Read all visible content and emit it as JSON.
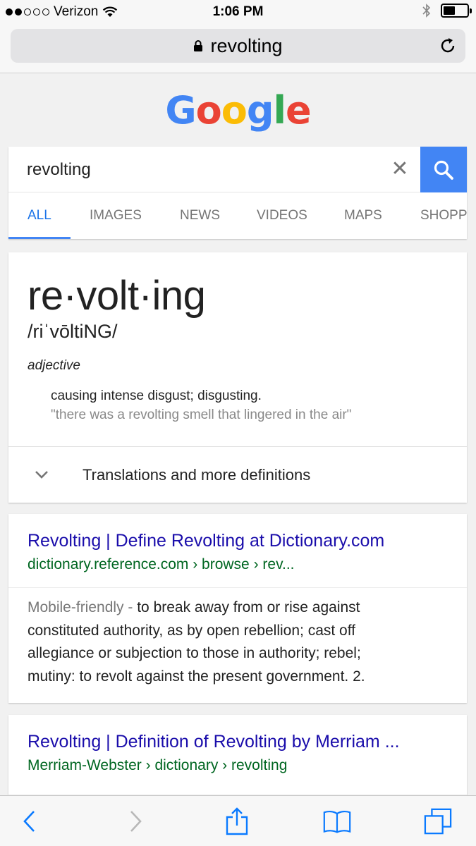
{
  "status_bar": {
    "carrier": "Verizon",
    "time": "1:06 PM",
    "signal_bars_filled": 2,
    "signal_bars_total": 5,
    "battery_level": 0.5
  },
  "address_bar": {
    "url_text": "revolting"
  },
  "logo": {
    "letters": [
      "G",
      "o",
      "o",
      "g",
      "l",
      "e"
    ],
    "colors": [
      "#4285f4",
      "#ea4335",
      "#fbbc05",
      "#4285f4",
      "#34a853",
      "#ea4335"
    ]
  },
  "search": {
    "query": "revolting",
    "clear_glyph": "✕"
  },
  "tabs": [
    {
      "label": "ALL",
      "active": true
    },
    {
      "label": "IMAGES",
      "active": false
    },
    {
      "label": "NEWS",
      "active": false
    },
    {
      "label": "VIDEOS",
      "active": false
    },
    {
      "label": "MAPS",
      "active": false
    },
    {
      "label": "SHOPP",
      "active": false
    }
  ],
  "dictionary": {
    "word": "re·volt·ing",
    "phonetic": "/riˈvōltiNG/",
    "part_of_speech": "adjective",
    "definition": "causing intense disgust; disgusting.",
    "example": "\"there was a revolting smell that lingered in the air\"",
    "more_label": "Translations and more definitions"
  },
  "results": [
    {
      "title": "Revolting | Define Revolting at Dictionary.com",
      "url": "dictionary.reference.com › browse › rev...",
      "prefix": "Mobile-friendly - ",
      "snippet_lines": [
        "to break away from or rise against",
        "constituted authority, as by open rebellion; cast off",
        "allegiance or subjection to those in authority; rebel;",
        "mutiny: to revolt against the present government. 2."
      ]
    },
    {
      "title": "Revolting | Definition of Revolting by Merriam ...",
      "url": "Merriam-Webster › dictionary › revolting"
    }
  ],
  "colors": {
    "link": "#1a0dab",
    "url_green": "#006621",
    "accent_blue": "#4285f4",
    "ios_blue": "#0a7aff"
  }
}
